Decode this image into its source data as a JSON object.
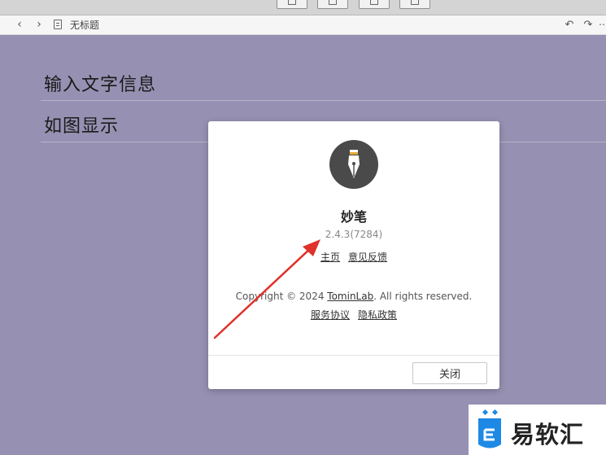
{
  "window": {
    "doc_title": "无标题"
  },
  "editor": {
    "lines": [
      "输入文字信息",
      "如图显示"
    ]
  },
  "about_dialog": {
    "app_name": "妙笔",
    "version": "2.4.3(7284)",
    "link_home": "主页",
    "link_feedback": "意见反馈",
    "copyright_prefix": "Copyright © 2024 ",
    "copyright_company": "TominLab",
    "copyright_suffix": ". All rights reserved.",
    "link_terms": "服务协议",
    "link_privacy": "隐私政策",
    "close_label": "关闭"
  },
  "watermark": {
    "text": "易软汇"
  },
  "icons": {
    "back": "chevron-left-icon",
    "forward": "chevron-right-icon",
    "document": "document-icon",
    "undo": "undo-icon",
    "redo": "redo-icon",
    "more": "more-icon",
    "logo": "fountain-pen-icon"
  },
  "colors": {
    "editor_bg": "#9691b2",
    "arrow": "#e0312a",
    "watermark_blue": "#1e88e5"
  }
}
